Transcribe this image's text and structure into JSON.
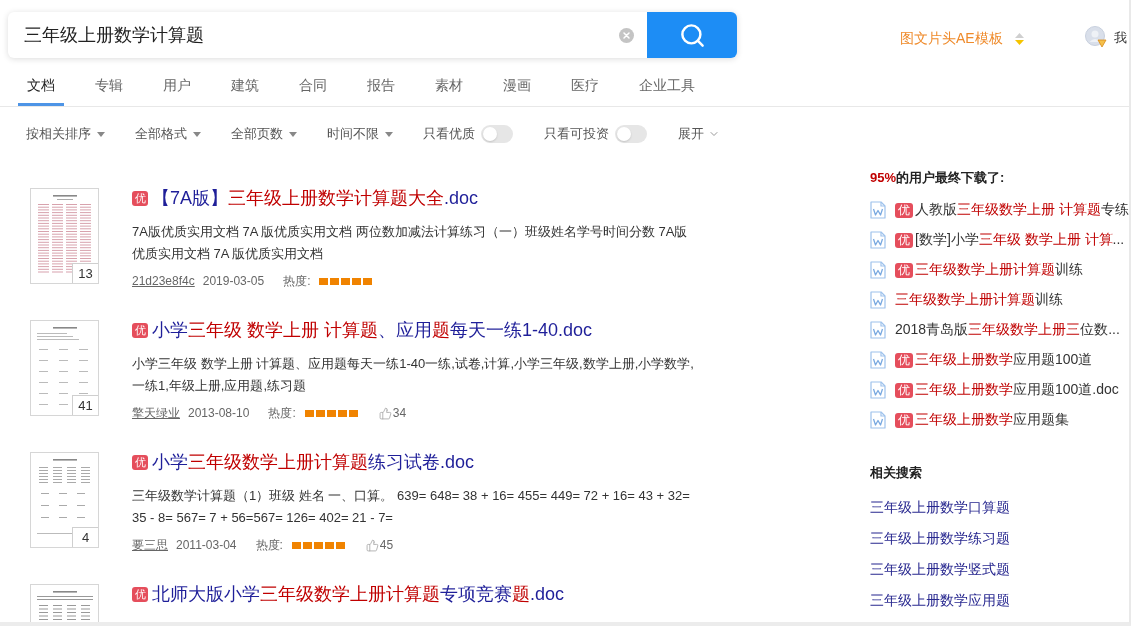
{
  "search": {
    "value": "三年级上册数学计算题"
  },
  "header_right": {
    "promo": "图文片头AE模板",
    "user_label": "我"
  },
  "tabs": [
    {
      "label": "文档",
      "selected": true
    },
    {
      "label": "专辑",
      "selected": false
    },
    {
      "label": "用户",
      "selected": false
    },
    {
      "label": "建筑",
      "selected": false
    },
    {
      "label": "合同",
      "selected": false
    },
    {
      "label": "报告",
      "selected": false
    },
    {
      "label": "素材",
      "selected": false
    },
    {
      "label": "漫画",
      "selected": false
    },
    {
      "label": "医疗",
      "selected": false
    },
    {
      "label": "企业工具",
      "selected": false
    }
  ],
  "filters": [
    {
      "kind": "dropdown",
      "label": "按相关排序"
    },
    {
      "kind": "dropdown",
      "label": "全部格式"
    },
    {
      "kind": "dropdown",
      "label": "全部页数"
    },
    {
      "kind": "dropdown",
      "label": "时间不限"
    },
    {
      "kind": "toggle",
      "label": "只看优质",
      "on": false
    },
    {
      "kind": "toggle",
      "label": "只看可投资",
      "on": false
    },
    {
      "kind": "expand",
      "label": "展开"
    }
  ],
  "results": [
    {
      "pages": "13",
      "badge": "优",
      "title": [
        {
          "text": "【7A版】",
          "highlight": false
        },
        {
          "text": "三年级上册数学计算题大全",
          "highlight": true
        },
        {
          "text": ".doc",
          "highlight": false
        }
      ],
      "description": "7A版优质实用文档 7A 版优质实用文档 两位数加减法计算练习（一）班级姓名学号时间分数 7A版优质实用文档 7A 版优质实用文档",
      "author": "21d23e8f4c",
      "date": "2019-03-05",
      "heat_label": "热度:",
      "stars": 5
    },
    {
      "pages": "41",
      "badge": "优",
      "title": [
        {
          "text": "小学",
          "highlight": false
        },
        {
          "text": "三年级 数学上册 计算题",
          "highlight": true
        },
        {
          "text": "、应用",
          "highlight": false
        },
        {
          "text": "题",
          "highlight": true
        },
        {
          "text": "每天一练1-40.doc",
          "highlight": false
        }
      ],
      "description": "小学三年级 数学上册 计算题、应用题每天一练1-40一练,试卷,计算,小学三年级,数学上册,小学数学,一练1,年级上册,应用题,练习题",
      "author": "擎天绿业",
      "date": "2013-08-10",
      "heat_label": "热度:",
      "stars": 5,
      "likes": "34"
    },
    {
      "pages": "4",
      "badge": "优",
      "title": [
        {
          "text": "小学",
          "highlight": false
        },
        {
          "text": "三年级数学上册计算题",
          "highlight": true
        },
        {
          "text": "练习试卷.doc",
          "highlight": false
        }
      ],
      "description": "三年级数学计算题（1）班级 姓名 一、口算。 639= 648= 38 + 16= 455= 449= 72 + 16= 43 + 32= 35 - 8= 567= 7 + 56=567= 126= 402= 21 - 7=",
      "author": "要三思",
      "date": "2011-03-04",
      "heat_label": "热度:",
      "stars": 5,
      "likes": "45"
    },
    {
      "badge": "优",
      "title": [
        {
          "text": "北师大版小学",
          "highlight": false
        },
        {
          "text": "三年级数学上册计算题",
          "highlight": true
        },
        {
          "text": "专项竞赛",
          "highlight": false
        },
        {
          "text": "题",
          "highlight": true
        },
        {
          "text": ".doc",
          "highlight": false
        }
      ]
    }
  ],
  "sidebar": {
    "downloads": {
      "heading": [
        {
          "text": "95%",
          "highlight": true
        },
        {
          "text": "的用户最终下载了:",
          "highlight": false
        }
      ],
      "items": [
        {
          "badge": "优",
          "title": [
            {
              "text": "人教版",
              "highlight": false
            },
            {
              "text": "三年级数学上册 计算题",
              "highlight": true
            },
            {
              "text": "专练",
              "highlight": false
            }
          ]
        },
        {
          "badge": "优",
          "title": [
            {
              "text": "[数学]小学",
              "highlight": false
            },
            {
              "text": "三年级 数学上册 计算",
              "highlight": true
            },
            {
              "text": "...",
              "highlight": false
            }
          ]
        },
        {
          "badge": "优",
          "title": [
            {
              "text": "三年级数学上册计算题",
              "highlight": true
            },
            {
              "text": "训练",
              "highlight": false
            }
          ]
        },
        {
          "title": [
            {
              "text": "三年级数学上册计算题",
              "highlight": true
            },
            {
              "text": "训练",
              "highlight": false
            }
          ]
        },
        {
          "title": [
            {
              "text": "2018青岛版",
              "highlight": false
            },
            {
              "text": "三年级数学上册三",
              "highlight": true
            },
            {
              "text": "位数...",
              "highlight": false
            }
          ]
        },
        {
          "badge": "优",
          "title": [
            {
              "text": "三年级上册数学",
              "highlight": true
            },
            {
              "text": "应用题100道",
              "highlight": false
            }
          ]
        },
        {
          "badge": "优",
          "title": [
            {
              "text": "三年级上册数学",
              "highlight": true
            },
            {
              "text": "应用题100道.doc",
              "highlight": false
            }
          ]
        },
        {
          "badge": "优",
          "title": [
            {
              "text": "三年级上册数学",
              "highlight": true
            },
            {
              "text": "应用题集",
              "highlight": false
            }
          ]
        }
      ]
    },
    "related": {
      "heading": "相关搜索",
      "links": [
        "三年级上册数学口算题",
        "三年级上册数学练习题",
        "三年级上册数学竖式题",
        "三年级上册数学应用题"
      ]
    }
  }
}
